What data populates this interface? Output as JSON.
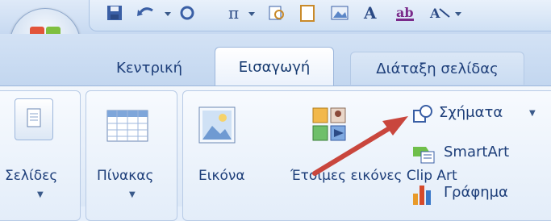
{
  "tabs": [
    {
      "label": "Κεντρική"
    },
    {
      "label": "Εισαγωγή"
    },
    {
      "label": "Διάταξη σελίδας"
    }
  ],
  "ribbon": {
    "pages_label": "Σελίδες",
    "table_label": "Πίνακας",
    "picture_label": "Εικόνα",
    "clipart_label": "Έτοιμες εικόνες Clip Art",
    "shapes_label": "Σχήματα",
    "smartart_label": "SmartArt",
    "chart_label": "Γράφημα"
  },
  "colors": {
    "accent": "#1e3f7a",
    "annotation_arrow": "#c9463d"
  }
}
